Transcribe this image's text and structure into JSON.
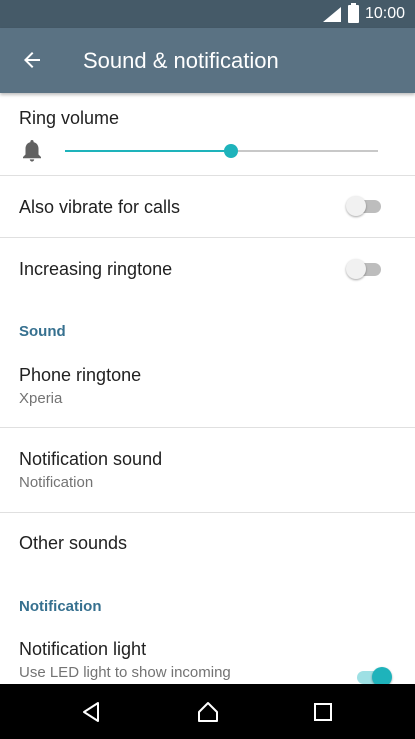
{
  "status_bar": {
    "time": "10:00",
    "icons": [
      "signal-icon",
      "battery-icon"
    ]
  },
  "app_bar": {
    "title": "Sound & notification",
    "back_icon": "arrow-left-icon"
  },
  "settings": {
    "ring_volume": {
      "label": "Ring volume",
      "icon": "bell-icon",
      "level": 0.53
    },
    "also_vibrate": {
      "label": "Also vibrate for calls",
      "enabled": false
    },
    "increasing_ringtone": {
      "label": "Increasing ringtone",
      "enabled": false
    },
    "sound_section": {
      "label": "Sound"
    },
    "phone_ringtone": {
      "label": "Phone ringtone",
      "value": "Xperia"
    },
    "notification_sound": {
      "label": "Notification sound",
      "value": "Notification"
    },
    "other_sounds": {
      "label": "Other sounds"
    },
    "notification_section": {
      "label": "Notification"
    },
    "notification_light": {
      "label": "Notification light",
      "summary": "Use LED light to show incoming",
      "enabled": true
    }
  },
  "nav_bar": {
    "buttons": [
      "back-icon",
      "home-icon",
      "recents-icon"
    ]
  },
  "colors": {
    "status_bar": "#455a68",
    "app_bar": "#5a7283",
    "accent": "#1eb3bb",
    "section_header": "#36708f"
  }
}
